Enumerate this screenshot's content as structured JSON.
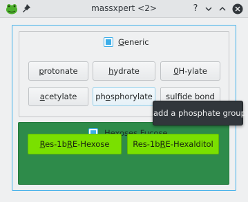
{
  "window": {
    "title": "massxpert <2>",
    "help_glyph": "?"
  },
  "generic": {
    "checkbox_checked": true,
    "label_u": "G",
    "label_rest": "eneric",
    "buttons": {
      "protonate": {
        "u": "p",
        "rest": "rotonate"
      },
      "hydrate": {
        "u": "h",
        "rest": "ydrate"
      },
      "ohylate": {
        "u": "0",
        "rest": "H-ylate"
      },
      "acetylate": {
        "u": "a",
        "rest": "cetylate"
      },
      "phosphorylate": {
        "pre": "ph",
        "u": "o",
        "rest": "sphorylate"
      },
      "sulfide": {
        "text": "sulfide bond"
      }
    }
  },
  "tooltip": {
    "text": "add a phosphate group"
  },
  "hexoses": {
    "checkbox_checked": true,
    "label_pre": "Hexoses ",
    "label_u": "F",
    "label_rest": "ucose",
    "buttons": {
      "hexose": {
        "u": "R",
        "mid": "es-1b",
        "u2": "R",
        "rest": "E-Hexose"
      },
      "hexalditol": {
        "pre": "Res-1b",
        "u": "R",
        "rest": "E-Hexalditol"
      }
    }
  },
  "colors": {
    "accent": "#3daee9",
    "group_green": "#2e8b4a",
    "button_green": "#7ae000",
    "tooltip_bg": "#31363b"
  }
}
